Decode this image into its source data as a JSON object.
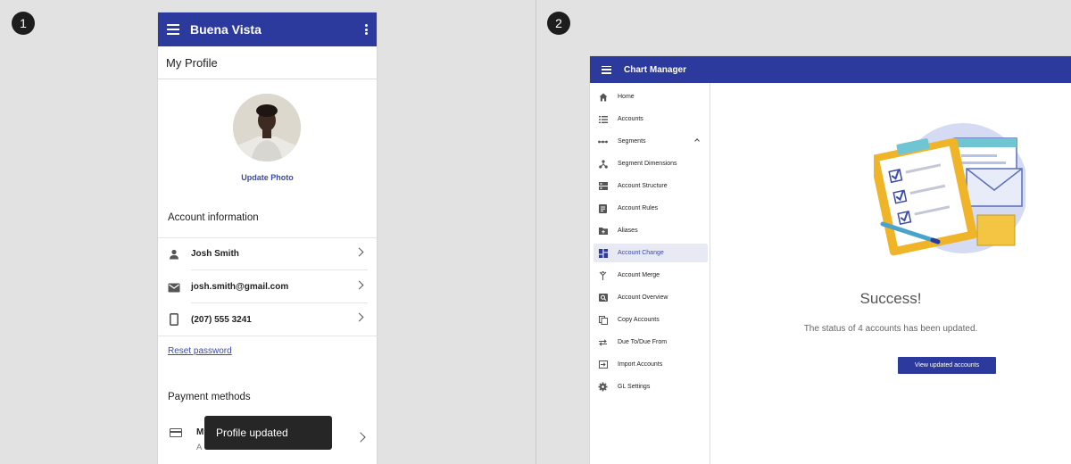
{
  "badges": {
    "one": "1",
    "two": "2"
  },
  "phone": {
    "app_title": "Buena Vista",
    "page_title": "My Profile",
    "update_photo_label": "Update Photo",
    "account_section_title": "Account information",
    "account_rows": [
      {
        "icon": "person-icon",
        "text": "Josh Smith"
      },
      {
        "icon": "email-icon",
        "text": "josh.smith@gmail.com"
      },
      {
        "icon": "phone-icon",
        "text": "(207) 555 3241"
      }
    ],
    "reset_password_label": "Reset password",
    "payment_section_title": "Payment methods",
    "payment_row": {
      "icon": "credit-card-icon",
      "name": "M",
      "sub": "A                      65"
    },
    "snackbar_text": "Profile updated"
  },
  "desktop": {
    "app_title": "Chart Manager",
    "nav_items": [
      {
        "label": "Home",
        "icon": "home-icon"
      },
      {
        "label": "Accounts",
        "icon": "list-icon"
      },
      {
        "label": "Segments",
        "icon": "segments-icon"
      },
      {
        "label": "Segment Dimensions",
        "icon": "hierarchy-icon"
      },
      {
        "label": "Account Structure",
        "icon": "structure-icon"
      },
      {
        "label": "Account Rules",
        "icon": "rules-icon"
      },
      {
        "label": "Aliases",
        "icon": "folder-icon"
      },
      {
        "label": "Account Change",
        "icon": "dashboard-icon"
      },
      {
        "label": "Account Merge",
        "icon": "merge-icon"
      },
      {
        "label": "Account Overview",
        "icon": "overview-icon"
      },
      {
        "label": "Copy Accounts",
        "icon": "copy-icon"
      },
      {
        "label": "Due To/Due From",
        "icon": "swap-icon"
      },
      {
        "label": "Import Accounts",
        "icon": "import-icon"
      },
      {
        "label": "GL Settings",
        "icon": "gear-icon"
      }
    ],
    "active_nav": "Account Change",
    "success_title": "Success!",
    "success_message": "The status of 4 accounts has been updated.",
    "view_button_label": "View updated accounts"
  },
  "colors": {
    "primary": "#2d3a9d",
    "link": "#3a4ba8",
    "active_nav_bg": "#e8eaf3",
    "snackbar_bg": "#262626"
  }
}
